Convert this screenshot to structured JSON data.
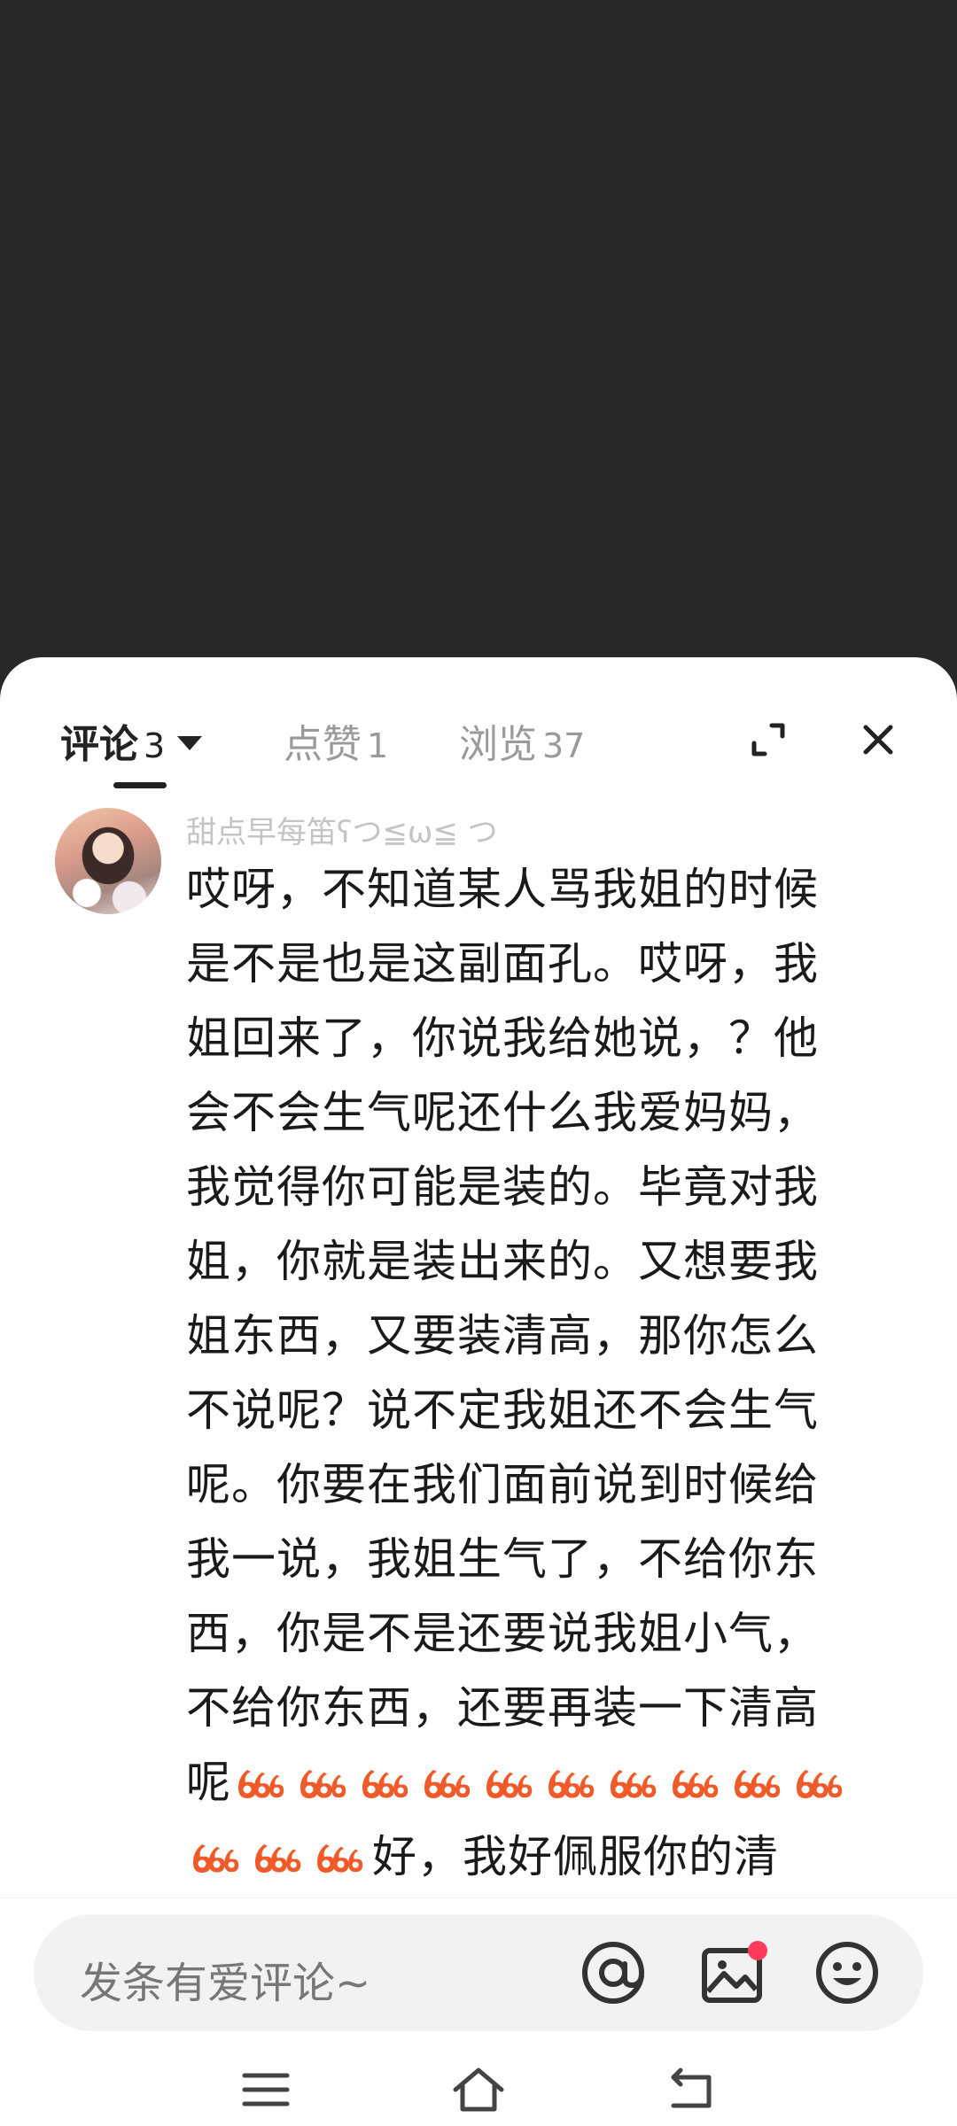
{
  "tabs": [
    {
      "label": "评论",
      "count": "3"
    },
    {
      "label": "点赞",
      "count": "1"
    },
    {
      "label": "浏览",
      "count": "37"
    }
  ],
  "comment": {
    "username": "甜点早每笛ʕつ≦ω≦ つ",
    "lines": [
      "哎呀，不知道某人骂我姐的时候",
      "是不是也是这副面孔。哎呀，我",
      "姐回来了，你说我给她说，？他",
      "会不会生气呢还什么我爱妈妈，",
      "我觉得你可能是装的。毕竟对我",
      "姐，你就是装出来的。又想要我",
      "姐东西，又要装清高，那你怎么",
      "不说呢？说不定我姐还不会生气",
      "呢。你要在我们面前说到时候给",
      "我一说，我姐生气了，不给你东",
      "西，你是不是还要说我姐小气，",
      "不给你东西，还要再装一下清高"
    ],
    "line13_prefix": "呢",
    "line13_emoji_count": 10,
    "line14_emoji_count": 3,
    "line14_text": "好，我好佩服你的清",
    "emoji_icon": "666-fire-emoji"
  },
  "input": {
    "placeholder": "发条有爱评论~"
  },
  "colors": {
    "backdrop": "#272827",
    "badge": "#ff3b5c",
    "emoji_fill": "#f05a28"
  }
}
